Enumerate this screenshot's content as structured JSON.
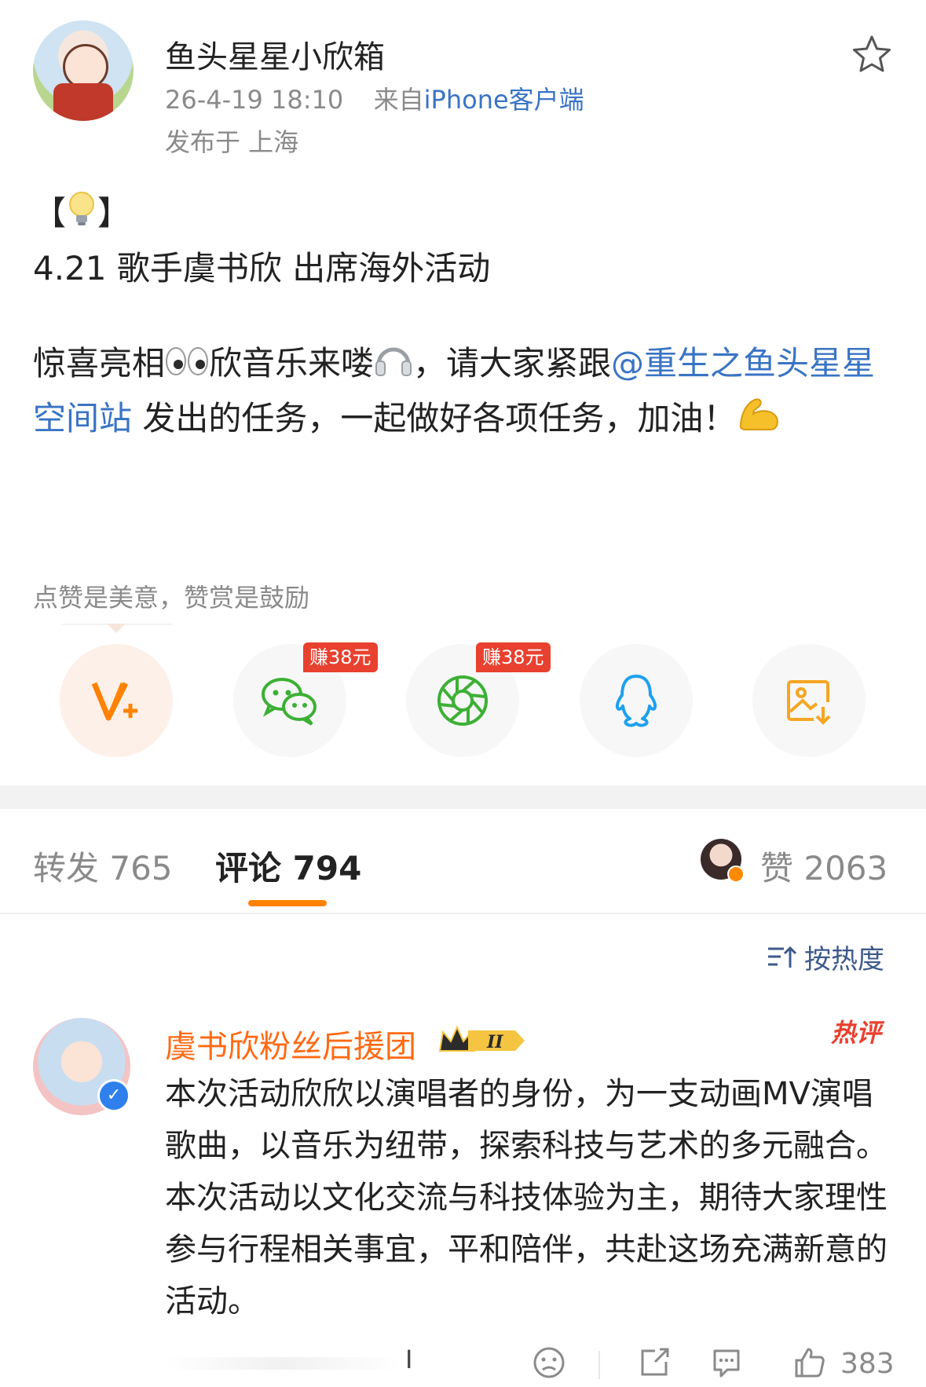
{
  "post": {
    "username": "鱼头星星小欣箱",
    "time": "26-4-19 18:10",
    "source_prefix": "来自",
    "source_app": "iPhone客户端",
    "location": "发布于 上海",
    "title_line": "4.21 歌手虞书欣 出席海外活动",
    "body_part1": "惊喜亮相",
    "body_part2": "欣音乐来喽",
    "body_part3": "，请大家紧跟",
    "mention": "@重生之鱼头星星空间站",
    "body_part4": " 发出的任务，一起做好各项任务，加油！",
    "bracket_left": "【",
    "bracket_right": "】"
  },
  "reward": {
    "tip": "点赞是美意，赞赏是鼓励",
    "earn_badge_wechat": "赚38元",
    "earn_badge_moments": "赚38元"
  },
  "share_icons": [
    "v-plus-icon",
    "wechat-icon",
    "moments-icon",
    "qq-icon",
    "save-image-icon"
  ],
  "tabs": {
    "repost_label": "转发 765",
    "comment_label": "评论 794",
    "like_label": "赞 2063"
  },
  "sort": {
    "label": "按热度"
  },
  "comment": {
    "name": "虞书欣粉丝后援团",
    "badge_level": "II",
    "hot_tag": "热评",
    "text": "本次活动欣欣以演唱者的身份，为一支动画MV演唱歌曲，以音乐为纽带，探索科技与艺术的多元融合。 本次活动以文化交流与科技体验为主，期待大家理性参与行程相关事宜，平和陪伴，共赴这场充满新意的活动。",
    "cursor": "I",
    "like_count": "383"
  },
  "colors": {
    "accent_orange": "#ff8200",
    "link_blue": "#3a74c4",
    "hot_red": "#e8412f"
  }
}
